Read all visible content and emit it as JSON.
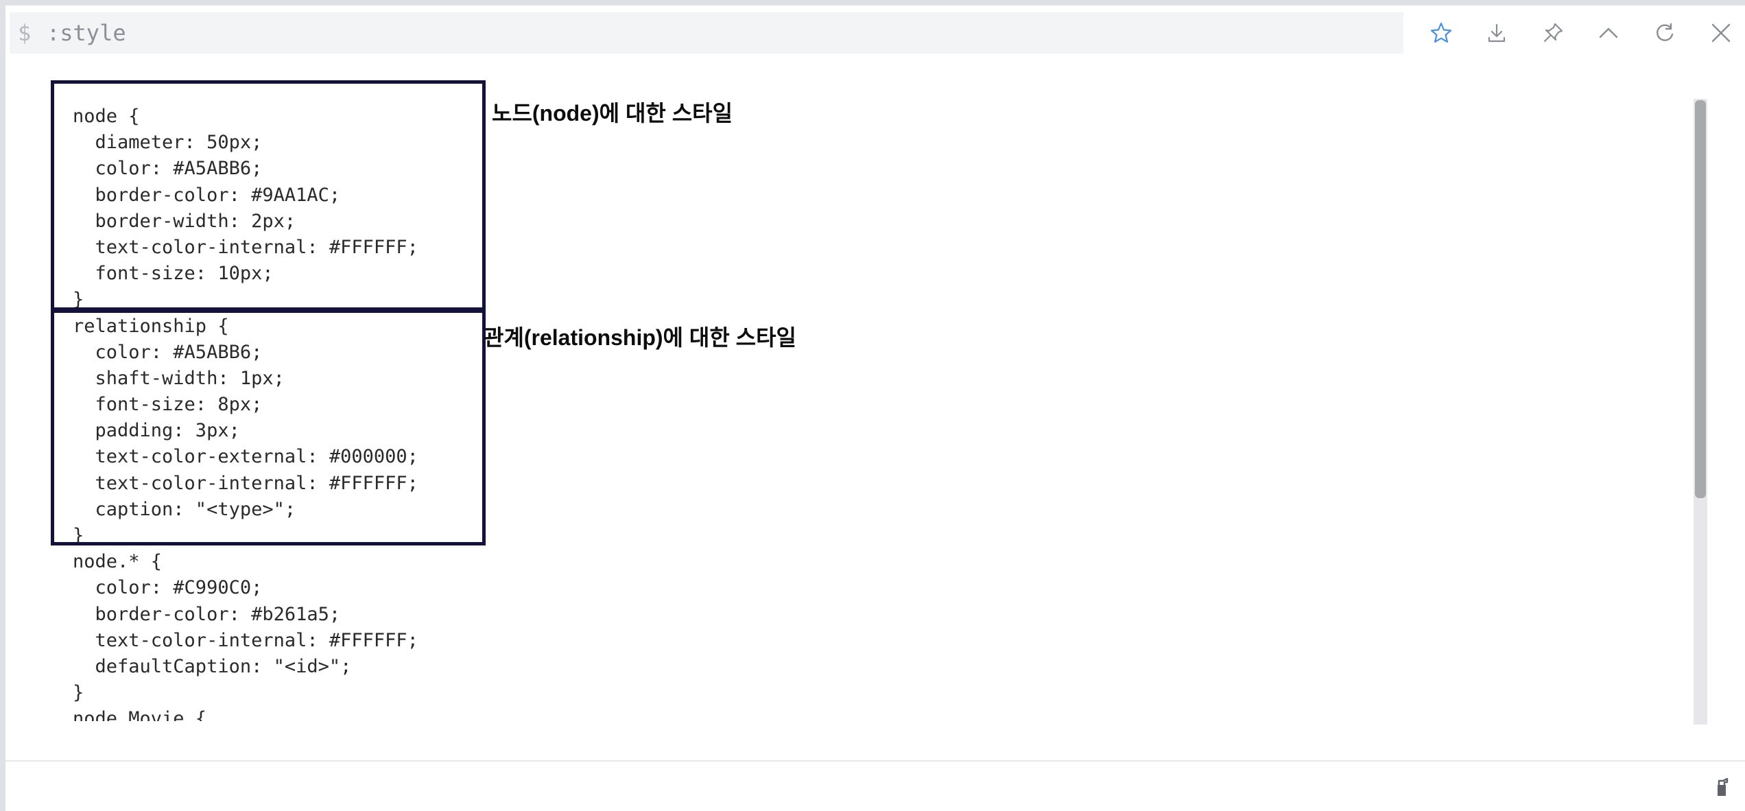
{
  "command": {
    "prompt": "$",
    "text": ":style"
  },
  "toolbar": {
    "favorite": "star-icon",
    "download": "download-icon",
    "pin": "pin-icon",
    "collapse": "chevron-up-icon",
    "rerun": "rerun-icon",
    "close": "close-icon",
    "accent_color": "#4a90e2"
  },
  "code_lines": [
    "node {",
    "  diameter: 50px;",
    "  color: #A5ABB6;",
    "  border-color: #9AA1AC;",
    "  border-width: 2px;",
    "  text-color-internal: #FFFFFF;",
    "  font-size: 10px;",
    "}",
    "relationship {",
    "  color: #A5ABB6;",
    "  shaft-width: 1px;",
    "  font-size: 8px;",
    "  padding: 3px;",
    "  text-color-external: #000000;",
    "  text-color-internal: #FFFFFF;",
    "  caption: \"<type>\";",
    "}",
    "node.* {",
    "  color: #C990C0;",
    "  border-color: #b261a5;",
    "  text-color-internal: #FFFFFF;",
    "  defaultCaption: \"<id>\";",
    "}",
    "node.Movie {"
  ],
  "annotations": {
    "node_style": "노드(node)에 대한 스타일",
    "relationship_style": "관계(relationship)에 대한 스타일"
  },
  "footer": {
    "clear_icon": "eraser-icon"
  }
}
